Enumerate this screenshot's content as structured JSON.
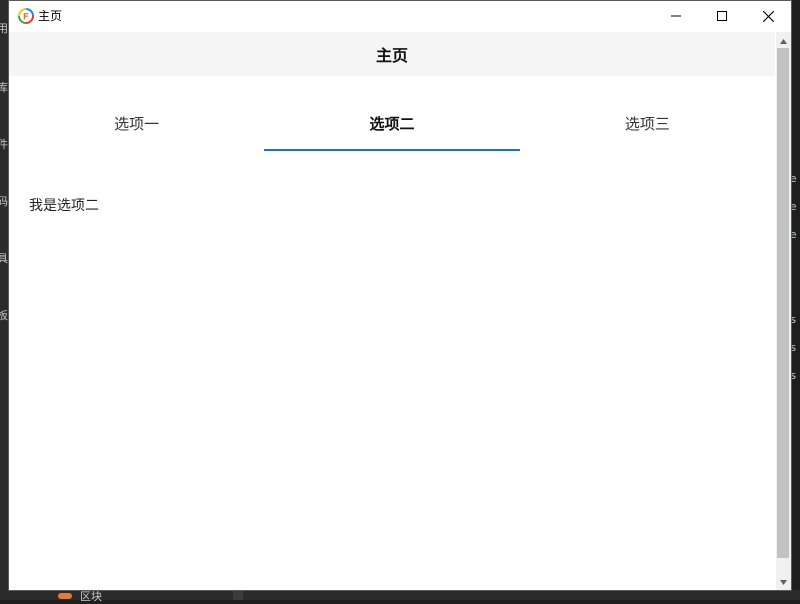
{
  "window": {
    "title": "主页",
    "app_icon": "app-logo-icon"
  },
  "controls": {
    "minimize": "minimize-icon",
    "maximize": "maximize-icon",
    "close": "close-icon"
  },
  "header": {
    "title": "主页"
  },
  "tabs": [
    {
      "label": "选项一",
      "active": false
    },
    {
      "label": "选项二",
      "active": true
    },
    {
      "label": "选项三",
      "active": false
    }
  ],
  "content": {
    "text": "我是选项二"
  },
  "background": {
    "left_glyphs": [
      "用",
      "库",
      "件",
      "码",
      "具",
      "板"
    ],
    "bottom_label": "区块"
  },
  "colors": {
    "accent": "#1f6fd1",
    "header_bg": "#f5f5f5"
  }
}
